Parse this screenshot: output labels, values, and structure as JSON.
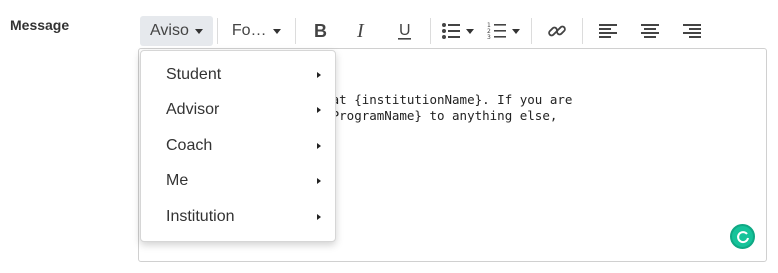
{
  "field": {
    "label": "Message"
  },
  "toolbar": {
    "template_dropdown": "Aviso",
    "font_dropdown": "Fo…",
    "buttons": [
      "bold",
      "italic",
      "underline",
      "bullet-list",
      "numbered-list",
      "link",
      "align-left",
      "align-center",
      "align-right"
    ]
  },
  "editor": {
    "body_text": "s for the upcoming term at {institutionName}. If you are\nur program from {studentProgramName} to anything else,\n straight away."
  },
  "menu": {
    "items": [
      {
        "label": "Student"
      },
      {
        "label": "Advisor"
      },
      {
        "label": "Coach"
      },
      {
        "label": "Me"
      },
      {
        "label": "Institution"
      }
    ]
  },
  "colors": {
    "accent_green": "#15c39a",
    "toolbar_active_bg": "#e6e9ed"
  }
}
